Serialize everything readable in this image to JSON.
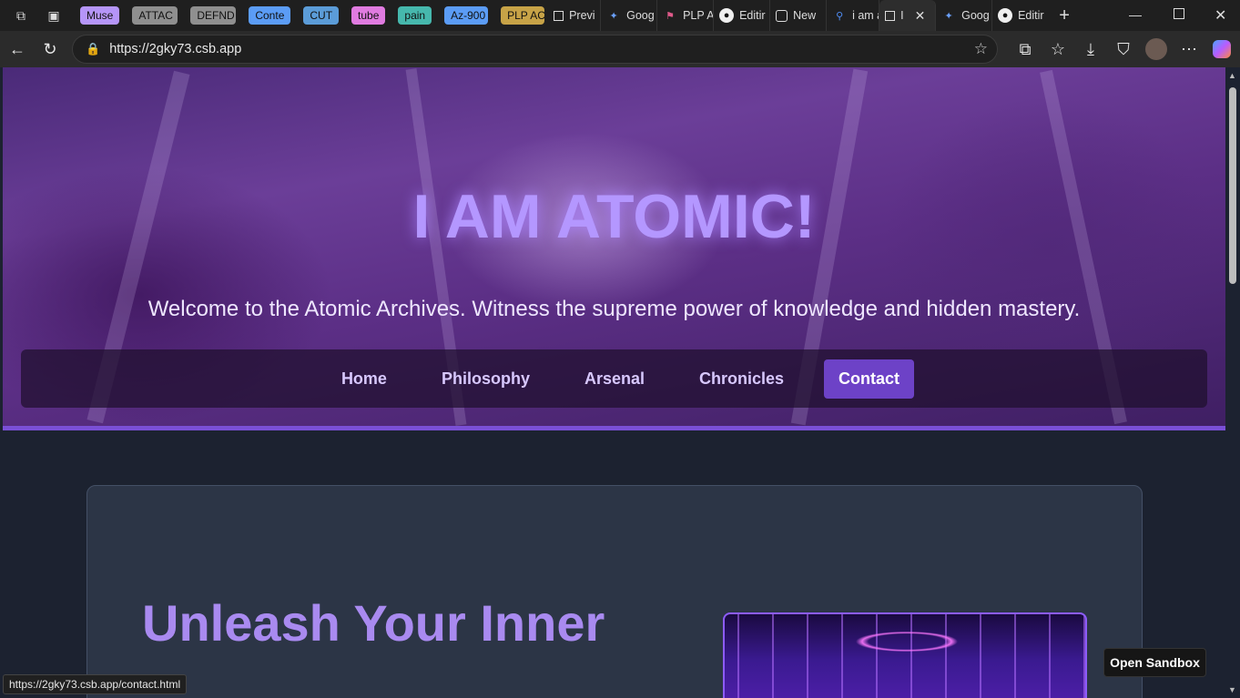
{
  "browser": {
    "tab_groups": [
      {
        "label": "Muse",
        "color": "#b595f8"
      },
      {
        "label": "ATTAC",
        "color": "#8f8f8f"
      },
      {
        "label": "DEFND",
        "color": "#8f8f8f"
      },
      {
        "label": "Conte",
        "color": "#5b9cf5"
      },
      {
        "label": "CUT",
        "color": "#5b9cd8"
      },
      {
        "label": "tube",
        "color": "#e07be0"
      },
      {
        "label": "pain",
        "color": "#46b8ad"
      },
      {
        "label": "Az-900",
        "color": "#5b9cf5"
      },
      {
        "label": "PLP AC",
        "color": "#c7a347"
      }
    ],
    "tabs": [
      {
        "label": "Previ",
        "icon": "codesandbox-icon"
      },
      {
        "label": "Goog",
        "icon": "gemini-icon"
      },
      {
        "label": "PLP A",
        "icon": "plp-icon"
      },
      {
        "label": "Editir",
        "icon": "github-icon"
      },
      {
        "label": "New",
        "icon": "newtab-icon"
      },
      {
        "label": "i am a",
        "icon": "search-icon"
      },
      {
        "label": "I",
        "icon": "codesandbox-icon",
        "active": true
      },
      {
        "label": "Goog",
        "icon": "gemini-icon"
      },
      {
        "label": "Editir",
        "icon": "github-icon"
      }
    ],
    "url": "https://2gky73.csb.app",
    "status_url": "https://2gky73.csb.app/contact.html"
  },
  "hero": {
    "title": "I AM ATOMIC!",
    "tagline": "Welcome to the Atomic Archives. Witness the supreme power of knowledge and hidden mastery."
  },
  "nav": {
    "items": [
      "Home",
      "Philosophy",
      "Arsenal",
      "Chronicles",
      "Contact"
    ],
    "active": "Contact"
  },
  "card": {
    "heading": "Unleash Your Inner"
  },
  "sandbox": {
    "open_label": "Open Sandbox"
  },
  "colors": {
    "accent": "#7a4fd6",
    "title": "#b497ff",
    "heading": "#a98af0",
    "card_bg": "#2c3546",
    "page_bg": "#1c2230"
  }
}
